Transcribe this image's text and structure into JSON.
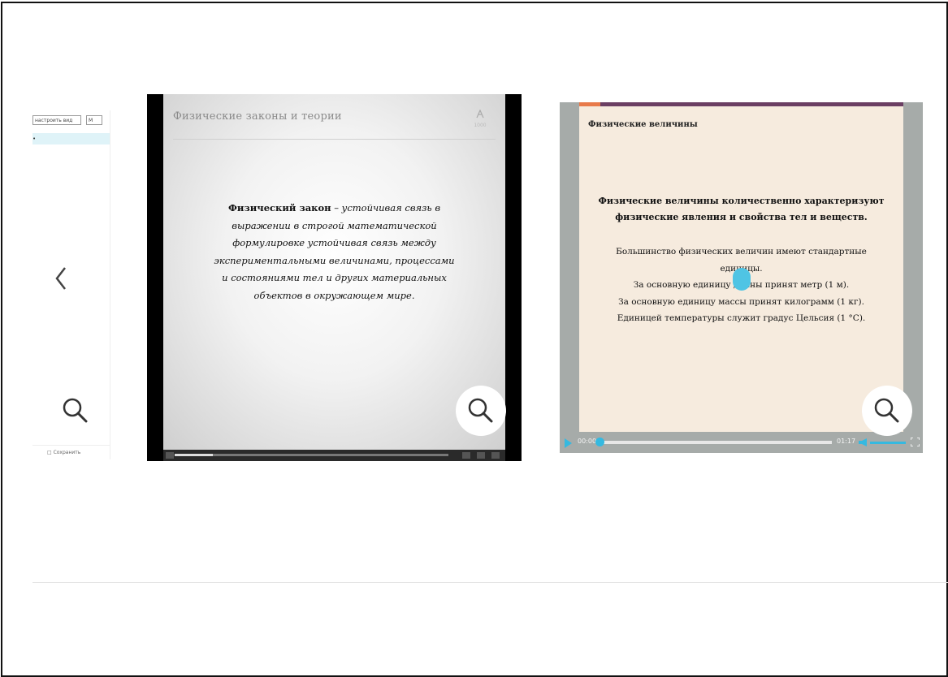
{
  "left_card": {
    "input_text": "настроить вид",
    "select_text": "М",
    "highlight_text": "•",
    "footer_text": "□ Сохранить"
  },
  "nav": {
    "prev_icon": "chevron-left-icon"
  },
  "slide1": {
    "title": "Физические законы и теории",
    "logo_sub": "1000",
    "text_bold": "Физический закон",
    "text_rest": " – устойчивая связь в выражении в строгой математической формулировке устойчивая связь между экспериментальными величинами, процессами и состояниями тел и других материальных объектов в окружающем мире."
  },
  "slide2": {
    "header": "Физические величины",
    "p1": "Физические величины количественно характеризуют физические явления и свойства тел и веществ.",
    "p2_line1": "Большинство физических величин имеют стандартные единицы.",
    "p2_line2": "За основную единицу длины принят метр (1 м).",
    "p2_line3": "За основную единицу массы принят килограмм (1 кг).",
    "p2_line4": "Единицей температуры служит градус Цельсия (1 °С).",
    "time_current": "00:00",
    "time_total": "01:17"
  },
  "colors": {
    "accent": "#35b9e0",
    "slide2_bg": "#f6ebde",
    "slide2_topbar": "#6b3f63"
  }
}
